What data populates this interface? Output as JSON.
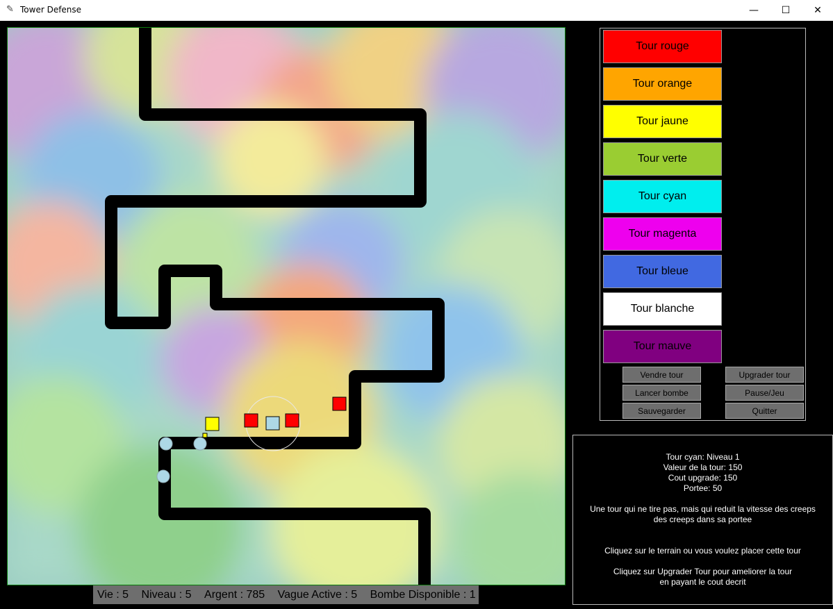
{
  "window": {
    "title": "Tower Defense",
    "minimize": "—",
    "maximize": "☐",
    "close": "✕"
  },
  "status": {
    "vie": "Vie : 5",
    "niveau": "Niveau : 5",
    "argent": "Argent : 785",
    "vague": "Vague Active : 5",
    "bombe": "Bombe Disponible : 1"
  },
  "towers": [
    {
      "label": "Tour rouge",
      "color": "#ff0000"
    },
    {
      "label": "Tour orange",
      "color": "#ffa500"
    },
    {
      "label": "Tour jaune",
      "color": "#ffff00"
    },
    {
      "label": "Tour verte",
      "color": "#9acd32"
    },
    {
      "label": "Tour cyan",
      "color": "#00eeee"
    },
    {
      "label": "Tour magenta",
      "color": "#ee00ee"
    },
    {
      "label": "Tour bleue",
      "color": "#4169e1"
    },
    {
      "label": "Tour blanche",
      "color": "#ffffff"
    },
    {
      "label": "Tour mauve",
      "color": "#800080"
    }
  ],
  "actions": {
    "vendre": "Vendre tour",
    "upgrader": "Upgrader tour",
    "bombe": "Lancer bombe",
    "pause": "Pause/Jeu",
    "sauvegarder": "Sauvegarder",
    "quitter": "Quitter"
  },
  "info": {
    "line1": "Tour cyan: Niveau 1",
    "line2": "Valeur de la tour: 150",
    "line3": "Cout upgrade: 150",
    "line4": "Portee: 50",
    "desc1": "Une tour qui ne tire pas, mais qui reduit la vitesse des creeps",
    "desc2": "des creeps dans sa portee",
    "hint1": "Cliquez sur le terrain ou vous voulez placer cette tour",
    "hint2": "Cliquez sur Upgrader Tour pour ameliorer la tour",
    "hint3": "en payant le cout decrit"
  },
  "colors": {
    "path": "#000000",
    "creep": "#add8e6",
    "red_tower": "#ff0000",
    "yellow_tower": "#ffff00",
    "cyan_slow_tower": "#add8e6"
  }
}
